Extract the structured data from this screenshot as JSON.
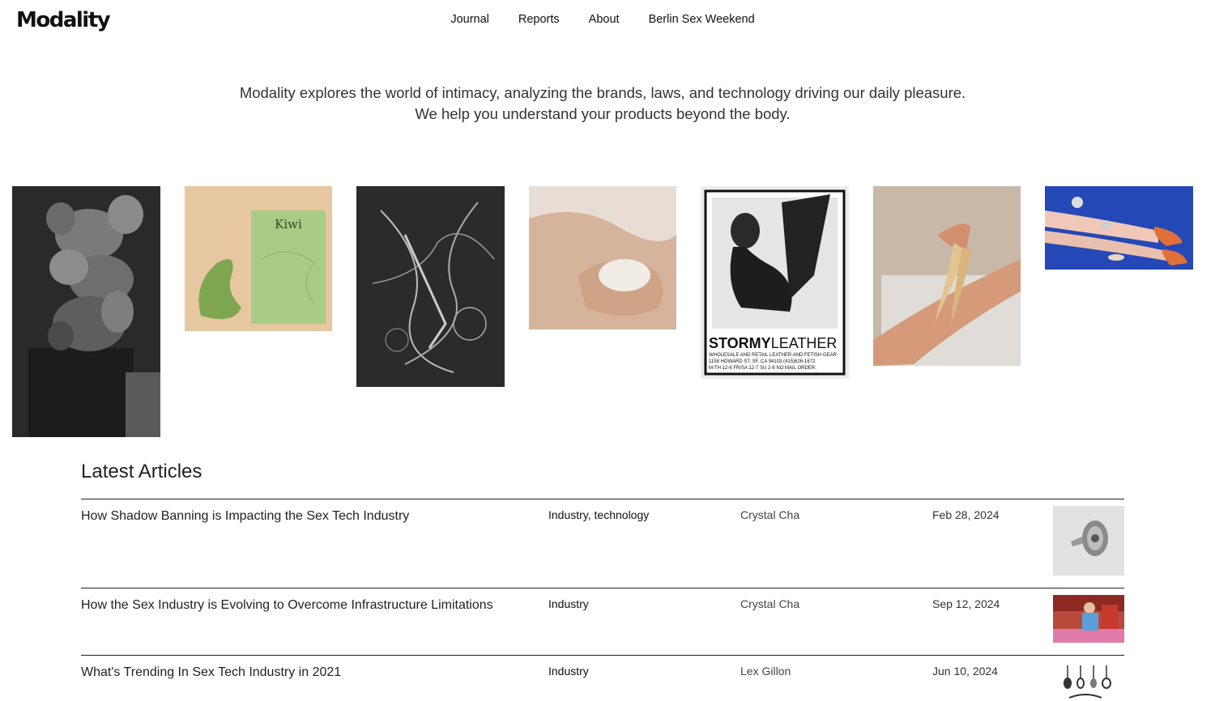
{
  "brand": {
    "name": "Modality"
  },
  "nav": {
    "items": [
      {
        "label": "Journal"
      },
      {
        "label": "Reports"
      },
      {
        "label": "About"
      },
      {
        "label": "Berlin Sex Weekend"
      }
    ]
  },
  "intro": {
    "line1": "Modality explores the world of intimacy, analyzing the brands, laws, and technology driving our daily pleasure.",
    "line2": "We help you understand your products beyond the body."
  },
  "gallery": {
    "images": [
      {
        "subject": "sculpture-photo"
      },
      {
        "subject": "kiwi-product",
        "text": "Kiwi"
      },
      {
        "subject": "abstract-drawing"
      },
      {
        "subject": "hand-with-stone"
      },
      {
        "subject": "stormy-leather-poster",
        "headline_bold": "STORMY",
        "headline_light": "LEATHER",
        "line1": "WHOLESALE AND RETAIL LEATHER AND FETISH GEAR",
        "line2": "1158 HOWARD ST. SF, CA 94103 (415)626-1672",
        "line3": "M-TH 12-6 FR/SA 12-7 SU 2-6    NO MAIL ORDER."
      },
      {
        "subject": "hair-on-arm"
      },
      {
        "subject": "legs-blue-background"
      }
    ]
  },
  "latest": {
    "heading": "Latest Articles",
    "articles": [
      {
        "title": "How Shadow Banning is Impacting the Sex Tech Industry",
        "category": "Industry, technology",
        "author": "Crystal Cha",
        "date": "Feb 28, 2024"
      },
      {
        "title": "How the Sex Industry is Evolving to Overcome Infrastructure Limitations",
        "category": "Industry",
        "author": "Crystal Cha",
        "date": "Sep 12, 2024"
      },
      {
        "title": "What's Trending In Sex Tech Industry in 2021",
        "category": "Industry",
        "author": "Lex Gillon",
        "date": "Jun 10, 2024"
      }
    ]
  }
}
